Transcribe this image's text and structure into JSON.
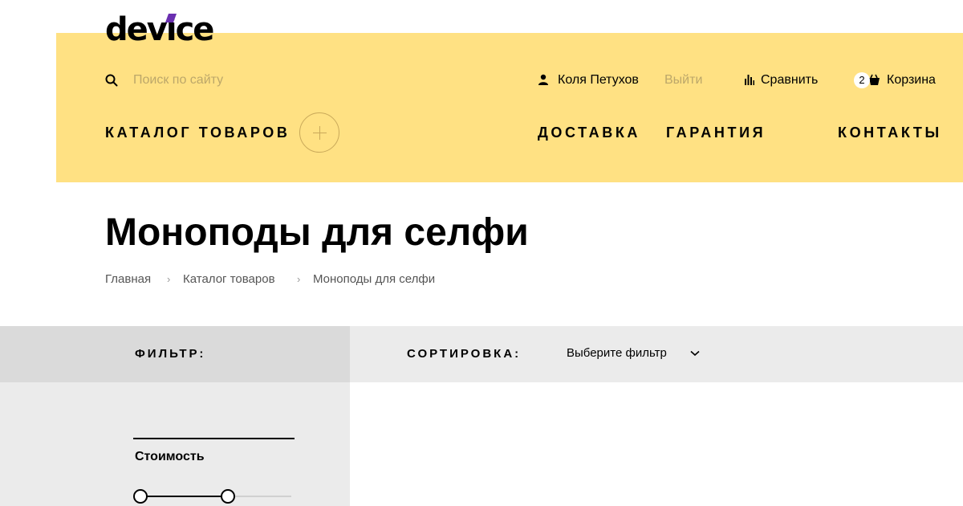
{
  "brand": {
    "logo_text_pre": "dev",
    "logo_text_i": "i",
    "logo_text_post": "ce",
    "accent_color": "#6a2fb0"
  },
  "header": {
    "background": "#ffe183",
    "search": {
      "placeholder": "Поиск по сайту",
      "value": ""
    },
    "user": {
      "name": "Коля Петухов",
      "logout_label": "Выйти"
    },
    "compare_label": "Сравнить",
    "cart": {
      "label": "Корзина",
      "count": "2"
    },
    "nav": {
      "catalog": "КАТАЛОГ ТОВАРОВ",
      "delivery": "ДОСТАВКА",
      "warranty": "ГАРАНТИЯ",
      "contacts": "КОНТАКТЫ"
    }
  },
  "page": {
    "title": "Моноподы для селфи",
    "breadcrumbs": [
      {
        "label": "Главная"
      },
      {
        "label": "Каталог товаров"
      },
      {
        "label": "Моноподы для селфи"
      }
    ],
    "breadcrumb_separator": "›"
  },
  "toolbar": {
    "filter_label": "ФИЛЬТР:",
    "sort_label": "СОРТИРОВКА:",
    "sort_value": "Выберите фильтр"
  },
  "filters": {
    "price": {
      "title": "Стоимость",
      "range_min_fraction": 0.0,
      "range_max_fraction": 0.57
    }
  },
  "icons": {
    "search": "search-icon",
    "user": "user-icon",
    "compare": "bar-chart-icon",
    "cart": "shopping-bag-icon",
    "catalog_toggle": "plus-icon",
    "sort": "chevron-down-icon"
  }
}
